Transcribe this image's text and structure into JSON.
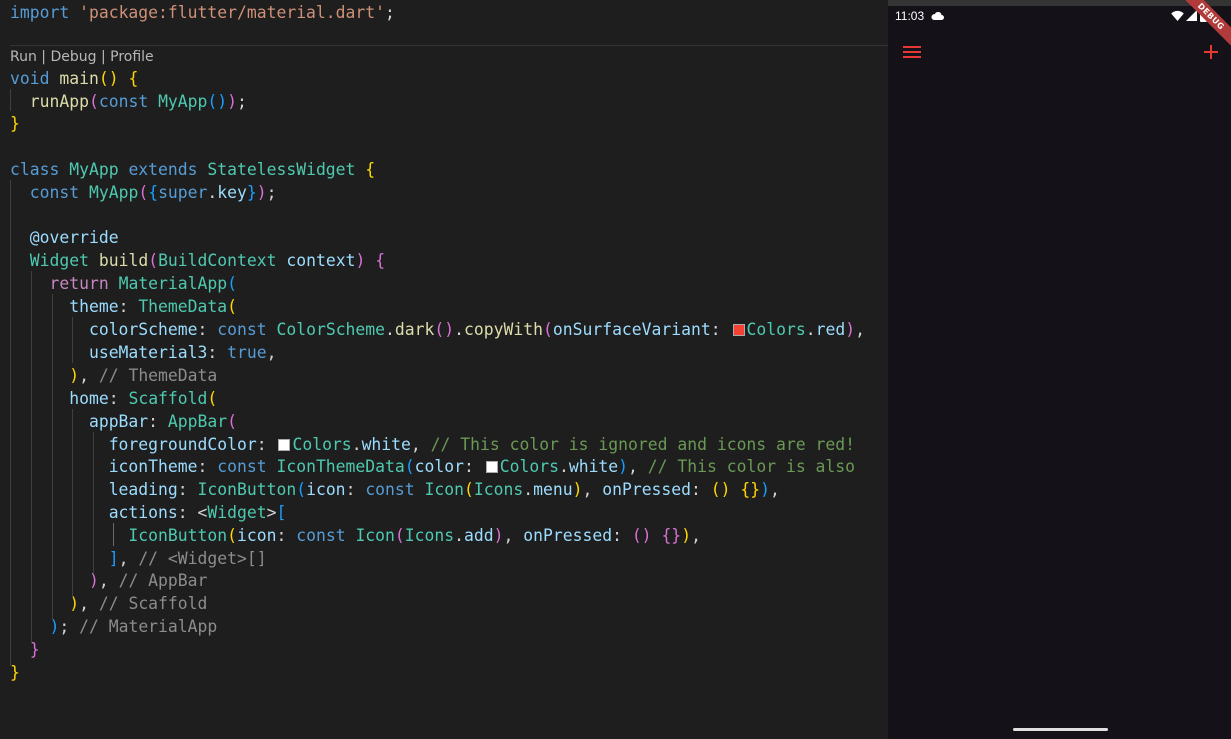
{
  "editor": {
    "codelens": "Run | Debug | Profile",
    "lines": [
      [
        [
          "kw",
          "import"
        ],
        [
          "pun",
          " "
        ],
        [
          "str",
          "'package:flutter/material.dart'"
        ],
        [
          "pun",
          ";"
        ]
      ],
      [
        [
          "kw",
          "void"
        ],
        [
          "pun",
          " "
        ],
        [
          "fn",
          "main"
        ],
        [
          "b1",
          "()"
        ],
        [
          "pun",
          " "
        ],
        [
          "b1",
          "{"
        ]
      ],
      [
        [
          "pun",
          "  "
        ],
        [
          "fn",
          "runApp"
        ],
        [
          "b2",
          "("
        ],
        [
          "kw",
          "const"
        ],
        [
          "pun",
          " "
        ],
        [
          "ty",
          "MyApp"
        ],
        [
          "b3",
          "()"
        ],
        [
          "b2",
          ")"
        ],
        [
          "pun",
          ";"
        ]
      ],
      [
        [
          "b1",
          "}"
        ]
      ],
      [
        [
          "kw",
          "class"
        ],
        [
          "pun",
          " "
        ],
        [
          "ty",
          "MyApp"
        ],
        [
          "pun",
          " "
        ],
        [
          "kw",
          "extends"
        ],
        [
          "pun",
          " "
        ],
        [
          "ty",
          "StatelessWidget"
        ],
        [
          "pun",
          " "
        ],
        [
          "b1",
          "{"
        ]
      ],
      [
        [
          "pun",
          "  "
        ],
        [
          "kw",
          "const"
        ],
        [
          "pun",
          " "
        ],
        [
          "ty",
          "MyApp"
        ],
        [
          "b2",
          "("
        ],
        [
          "b3",
          "{"
        ],
        [
          "kw",
          "super"
        ],
        [
          "pun",
          "."
        ],
        [
          "var",
          "key"
        ],
        [
          "b3",
          "}"
        ],
        [
          "b2",
          ")"
        ],
        [
          "pun",
          ";"
        ]
      ],
      [
        [
          "pun",
          "  "
        ],
        [
          "var",
          "@override"
        ]
      ],
      [
        [
          "pun",
          "  "
        ],
        [
          "ty",
          "Widget"
        ],
        [
          "pun",
          " "
        ],
        [
          "fn",
          "build"
        ],
        [
          "b2",
          "("
        ],
        [
          "ty",
          "BuildContext"
        ],
        [
          "pun",
          " "
        ],
        [
          "var",
          "context"
        ],
        [
          "b2",
          ")"
        ],
        [
          "pun",
          " "
        ],
        [
          "b2",
          "{"
        ]
      ],
      [
        [
          "pun",
          "    "
        ],
        [
          "kw2",
          "return"
        ],
        [
          "pun",
          " "
        ],
        [
          "ty",
          "MaterialApp"
        ],
        [
          "b3",
          "("
        ]
      ],
      [
        [
          "pun",
          "      "
        ],
        [
          "var",
          "theme"
        ],
        [
          "pun",
          ": "
        ],
        [
          "ty",
          "ThemeData"
        ],
        [
          "b1",
          "("
        ]
      ],
      [
        [
          "pun",
          "        "
        ],
        [
          "var",
          "colorScheme"
        ],
        [
          "pun",
          ": "
        ],
        [
          "kw",
          "const"
        ],
        [
          "pun",
          " "
        ],
        [
          "ty",
          "ColorScheme"
        ],
        [
          "pun",
          "."
        ],
        [
          "fn",
          "dark"
        ],
        [
          "b2",
          "()"
        ],
        [
          "pun",
          "."
        ],
        [
          "fn",
          "copyWith"
        ],
        [
          "b2",
          "("
        ],
        [
          "var",
          "onSurfaceVariant"
        ],
        [
          "pun",
          ": "
        ],
        [
          "swatch",
          "#f44336"
        ],
        [
          "ty",
          "Colors"
        ],
        [
          "pun",
          "."
        ],
        [
          "var",
          "red"
        ],
        [
          "b2",
          ")"
        ],
        [
          "pun",
          ","
        ]
      ],
      [
        [
          "pun",
          "        "
        ],
        [
          "var",
          "useMaterial3"
        ],
        [
          "pun",
          ": "
        ],
        [
          "kw",
          "true"
        ],
        [
          "pun",
          ","
        ]
      ],
      [
        [
          "pun",
          "      "
        ],
        [
          "b1",
          ")"
        ],
        [
          "pun",
          ", "
        ],
        [
          "cmg",
          "// ThemeData"
        ]
      ],
      [
        [
          "pun",
          "      "
        ],
        [
          "var",
          "home"
        ],
        [
          "pun",
          ": "
        ],
        [
          "ty",
          "Scaffold"
        ],
        [
          "b1",
          "("
        ]
      ],
      [
        [
          "pun",
          "        "
        ],
        [
          "var",
          "appBar"
        ],
        [
          "pun",
          ": "
        ],
        [
          "ty",
          "AppBar"
        ],
        [
          "b2",
          "("
        ]
      ],
      [
        [
          "pun",
          "          "
        ],
        [
          "var",
          "foregroundColor"
        ],
        [
          "pun",
          ": "
        ],
        [
          "swatch",
          "#ffffff"
        ],
        [
          "ty",
          "Colors"
        ],
        [
          "pun",
          "."
        ],
        [
          "var",
          "white"
        ],
        [
          "pun",
          ", "
        ],
        [
          "cm",
          "// This color is ignored and icons are red!"
        ]
      ],
      [
        [
          "pun",
          "          "
        ],
        [
          "var",
          "iconTheme"
        ],
        [
          "pun",
          ": "
        ],
        [
          "kw",
          "const"
        ],
        [
          "pun",
          " "
        ],
        [
          "ty",
          "IconThemeData"
        ],
        [
          "b3",
          "("
        ],
        [
          "var",
          "color"
        ],
        [
          "pun",
          ": "
        ],
        [
          "swatch",
          "#ffffff"
        ],
        [
          "ty",
          "Colors"
        ],
        [
          "pun",
          "."
        ],
        [
          "var",
          "white"
        ],
        [
          "b3",
          ")"
        ],
        [
          "pun",
          ", "
        ],
        [
          "cm",
          "// This color is also"
        ]
      ],
      [
        [
          "pun",
          "          "
        ],
        [
          "var",
          "leading"
        ],
        [
          "pun",
          ": "
        ],
        [
          "ty",
          "IconButton"
        ],
        [
          "b3",
          "("
        ],
        [
          "var",
          "icon"
        ],
        [
          "pun",
          ": "
        ],
        [
          "kw",
          "const"
        ],
        [
          "pun",
          " "
        ],
        [
          "ty",
          "Icon"
        ],
        [
          "b1",
          "("
        ],
        [
          "ty",
          "Icons"
        ],
        [
          "pun",
          "."
        ],
        [
          "var",
          "menu"
        ],
        [
          "b1",
          ")"
        ],
        [
          "pun",
          ", "
        ],
        [
          "var",
          "onPressed"
        ],
        [
          "pun",
          ": "
        ],
        [
          "b1",
          "()"
        ],
        [
          "pun",
          " "
        ],
        [
          "b1",
          "{}"
        ],
        [
          "b3",
          ")"
        ],
        [
          "pun",
          ","
        ]
      ],
      [
        [
          "pun",
          "          "
        ],
        [
          "var",
          "actions"
        ],
        [
          "pun",
          ": <"
        ],
        [
          "ty",
          "Widget"
        ],
        [
          "pun",
          ">"
        ],
        [
          "b3",
          "["
        ]
      ],
      [
        [
          "pun",
          "            "
        ],
        [
          "ty",
          "IconButton"
        ],
        [
          "b1",
          "("
        ],
        [
          "var",
          "icon"
        ],
        [
          "pun",
          ": "
        ],
        [
          "kw",
          "const"
        ],
        [
          "pun",
          " "
        ],
        [
          "ty",
          "Icon"
        ],
        [
          "b2",
          "("
        ],
        [
          "ty",
          "Icons"
        ],
        [
          "pun",
          "."
        ],
        [
          "var",
          "add"
        ],
        [
          "b2",
          ")"
        ],
        [
          "pun",
          ", "
        ],
        [
          "var",
          "onPressed"
        ],
        [
          "pun",
          ": "
        ],
        [
          "b2",
          "()"
        ],
        [
          "pun",
          " "
        ],
        [
          "b2",
          "{}"
        ],
        [
          "b1",
          ")"
        ],
        [
          "pun",
          ","
        ]
      ],
      [
        [
          "pun",
          "          "
        ],
        [
          "b3",
          "]"
        ],
        [
          "pun",
          ", "
        ],
        [
          "cmg",
          "// <Widget>[]"
        ]
      ],
      [
        [
          "pun",
          "        "
        ],
        [
          "b2",
          ")"
        ],
        [
          "pun",
          ", "
        ],
        [
          "cmg",
          "// AppBar"
        ]
      ],
      [
        [
          "pun",
          "      "
        ],
        [
          "b1",
          ")"
        ],
        [
          "pun",
          ", "
        ],
        [
          "cmg",
          "// Scaffold"
        ]
      ],
      [
        [
          "pun",
          "    "
        ],
        [
          "b3",
          ")"
        ],
        [
          "pun",
          "; "
        ],
        [
          "cmg",
          "// MaterialApp"
        ]
      ],
      [
        [
          "pun",
          "  "
        ],
        [
          "b2",
          "}"
        ]
      ],
      [
        [
          "b1",
          "}"
        ]
      ]
    ]
  },
  "phone": {
    "time": "11:03",
    "debug_banner": "DEBUG",
    "icons": {
      "leading": "menu-icon",
      "action": "add-icon",
      "status": [
        "cloud-icon",
        "wifi-icon",
        "signal-icon",
        "battery-icon"
      ]
    },
    "icon_color": "#e53935",
    "background": "#141218"
  }
}
